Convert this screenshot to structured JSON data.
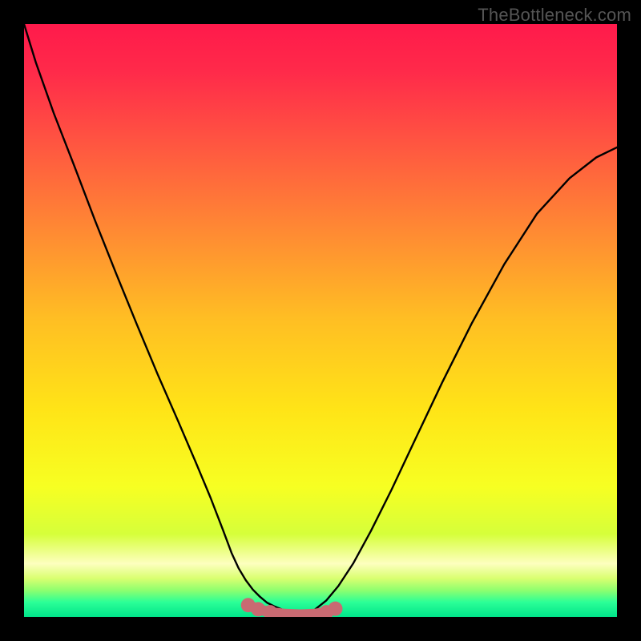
{
  "watermark": "TheBottleneck.com",
  "colors": {
    "curve_stroke": "#000000",
    "marker_stroke": "#c96a72",
    "marker_fill": "#c96a72",
    "bottom_path_stroke": "#c96a72",
    "gradient_stops": [
      {
        "offset": 0.0,
        "color": "#ff1a4b"
      },
      {
        "offset": 0.08,
        "color": "#ff2a4a"
      },
      {
        "offset": 0.2,
        "color": "#ff5541"
      },
      {
        "offset": 0.35,
        "color": "#ff8a33"
      },
      {
        "offset": 0.5,
        "color": "#ffbf23"
      },
      {
        "offset": 0.65,
        "color": "#ffe417"
      },
      {
        "offset": 0.78,
        "color": "#f7ff22"
      },
      {
        "offset": 0.86,
        "color": "#d6ff3a"
      },
      {
        "offset": 0.91,
        "color": "#fdffbf"
      },
      {
        "offset": 0.935,
        "color": "#d9ff70"
      },
      {
        "offset": 0.955,
        "color": "#8eff6f"
      },
      {
        "offset": 0.975,
        "color": "#2bff97"
      },
      {
        "offset": 1.0,
        "color": "#00e48a"
      }
    ]
  },
  "chart_data": {
    "type": "line",
    "title": "",
    "xlabel": "",
    "ylabel": "",
    "xlim": [
      0,
      1
    ],
    "ylim": [
      0,
      1
    ],
    "left_curve": {
      "x": [
        0.0,
        0.02,
        0.05,
        0.085,
        0.12,
        0.155,
        0.19,
        0.225,
        0.26,
        0.29,
        0.315,
        0.335,
        0.35,
        0.362,
        0.374,
        0.386,
        0.398,
        0.41,
        0.422,
        0.434,
        0.446,
        0.458,
        0.47
      ],
      "y": [
        1.0,
        0.935,
        0.85,
        0.76,
        0.668,
        0.58,
        0.494,
        0.41,
        0.33,
        0.26,
        0.2,
        0.148,
        0.108,
        0.082,
        0.062,
        0.046,
        0.034,
        0.024,
        0.018,
        0.013,
        0.009,
        0.006,
        0.004
      ]
    },
    "right_curve": {
      "x": [
        0.47,
        0.49,
        0.51,
        0.53,
        0.555,
        0.585,
        0.62,
        0.66,
        0.705,
        0.755,
        0.81,
        0.865,
        0.92,
        0.965,
        1.0
      ],
      "y": [
        0.004,
        0.012,
        0.028,
        0.052,
        0.09,
        0.145,
        0.215,
        0.3,
        0.395,
        0.495,
        0.595,
        0.68,
        0.74,
        0.775,
        0.792
      ]
    },
    "bottom_segment": {
      "x": [
        0.378,
        0.395,
        0.415,
        0.44,
        0.465,
        0.49,
        0.51,
        0.525
      ],
      "y": [
        0.02,
        0.013,
        0.008,
        0.005,
        0.004,
        0.005,
        0.008,
        0.014
      ]
    },
    "markers": [
      {
        "x": 0.378,
        "y": 0.02
      },
      {
        "x": 0.395,
        "y": 0.013
      },
      {
        "x": 0.415,
        "y": 0.008
      },
      {
        "x": 0.51,
        "y": 0.008
      },
      {
        "x": 0.525,
        "y": 0.014
      }
    ],
    "notes": "x and y are normalized 0..1. y=0 is the bottom (ideal/green), y=1 is the top (worst/red). The curve is a sharp V dipping to the floor near x≈0.47."
  }
}
